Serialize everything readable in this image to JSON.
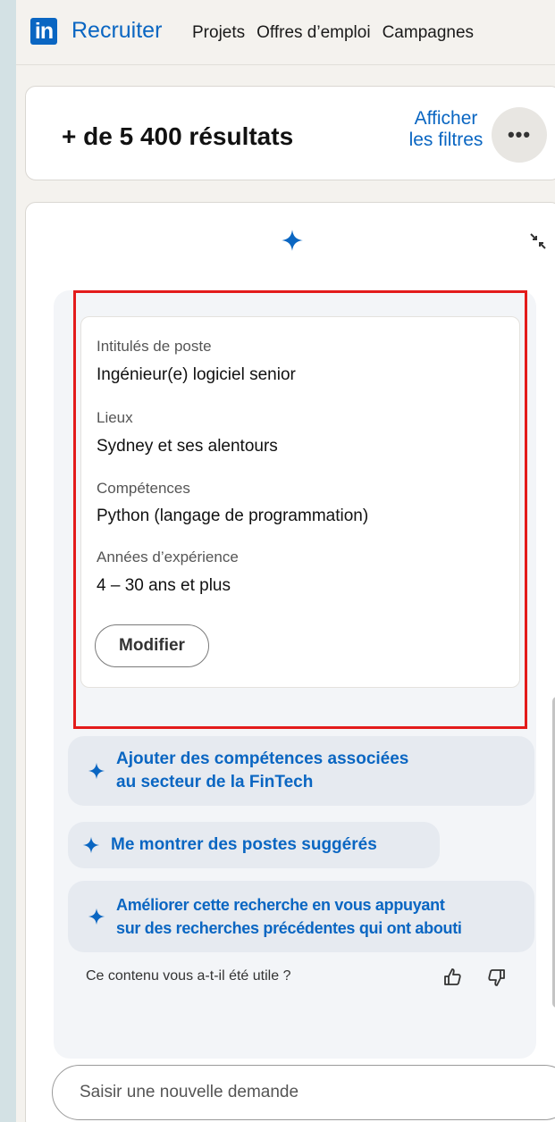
{
  "nav": {
    "logo": "in",
    "brand": "Recruiter",
    "links": [
      "Projets",
      "Offres d’emploi",
      "Campagnes"
    ]
  },
  "results": {
    "title": "+ de 5 400 résultats",
    "filters_line1": "Afficher",
    "filters_line2": "les filtres",
    "more_label": "•••"
  },
  "summary": {
    "fields": [
      {
        "label": "Intitulés de poste",
        "value": "Ingénieur(e) logiciel senior"
      },
      {
        "label": "Lieux",
        "value": "Sydney et ses alentours"
      },
      {
        "label": "Compétences",
        "value": "Python (langage de programmation)"
      },
      {
        "label": "Années d’expérience",
        "value": "4 – 30 ans et plus"
      }
    ],
    "modify_label": "Modifier"
  },
  "suggestions": [
    {
      "line1": "Ajouter des compétences associées",
      "line2": "au secteur de la FinTech"
    },
    {
      "line1": "Me montrer des postes suggérés",
      "line2": ""
    },
    {
      "line1": "Améliorer cette recherche en vous appuyant",
      "line2": "sur des recherches précédentes qui ont abouti"
    }
  ],
  "feedback": {
    "question": "Ce contenu vous a-t-il été utile ?"
  },
  "composer": {
    "placeholder": "Saisir une nouvelle demande"
  },
  "colors": {
    "accent": "#0a66c2",
    "highlight": "#e31b1b"
  }
}
